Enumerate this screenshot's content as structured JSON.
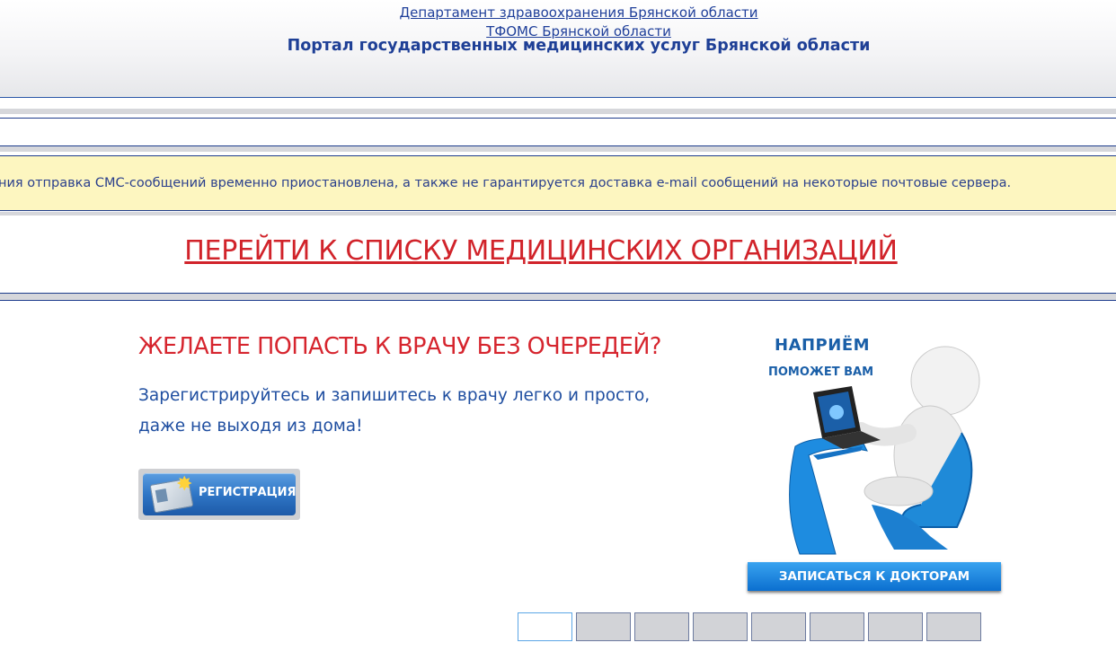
{
  "header": {
    "department_link": "Департамент здравоохранения Брянской области",
    "tfoms_link": "ТФОМС Брянской области",
    "portal_title": "Портал государственных медицинских услуг Брянской области"
  },
  "notice": {
    "text": "ния отправка СМС-сообщений временно приостановлена, а также не гарантируется доставка e-mail сообщений на некоторые почтовые сервера."
  },
  "main": {
    "org_list_link": "ПЕРЕЙТИ К СПИСКУ МЕДИЦИНСКИХ ОРГАНИЗАЦИЙ",
    "promo_title": "ЖЕЛАЕТЕ ПОПАСТЬ К ВРАЧУ БЕЗ ОЧЕРЕДЕЙ?",
    "promo_text": "Зарегистрируйтесь и запишитесь к врачу легко и просто, даже не выходя из дома!",
    "register_button": "РЕГИСТРАЦИЯ"
  },
  "banner": {
    "title": "НАПРИЁМ",
    "subtitle": "ПОМОЖЕТ ВАМ",
    "button": "ЗАПИСАТЬСЯ К ДОКТОРАМ"
  },
  "slider": {
    "active_index": 0,
    "count": 8
  },
  "colors": {
    "brand_blue": "#1f3f9a",
    "accent_red": "#d1232a",
    "notice_bg": "#fdf6c0"
  }
}
